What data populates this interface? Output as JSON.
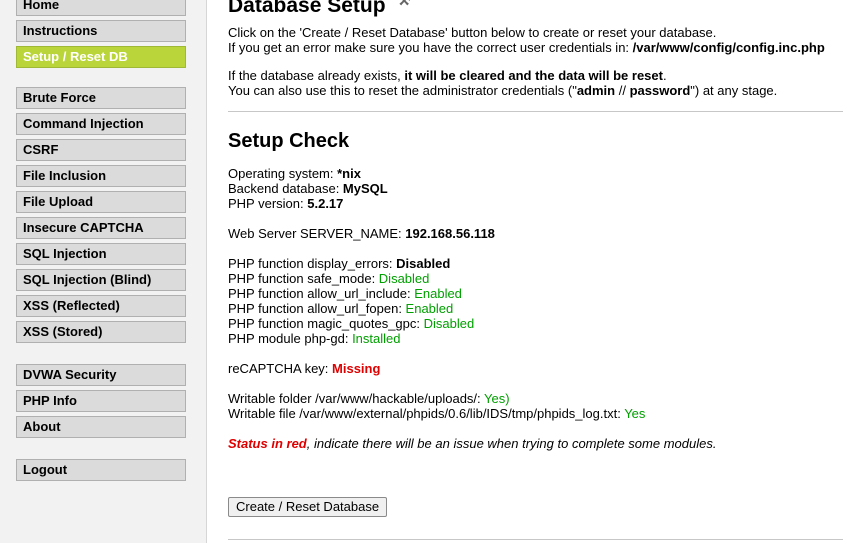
{
  "sidebar": {
    "group1": [
      {
        "label": "Home"
      },
      {
        "label": "Instructions"
      },
      {
        "label": "Setup / Reset DB",
        "selected": true
      }
    ],
    "group2": [
      {
        "label": "Brute Force"
      },
      {
        "label": "Command Injection"
      },
      {
        "label": "CSRF"
      },
      {
        "label": "File Inclusion"
      },
      {
        "label": "File Upload"
      },
      {
        "label": "Insecure CAPTCHA"
      },
      {
        "label": "SQL Injection"
      },
      {
        "label": "SQL Injection (Blind)"
      },
      {
        "label": "XSS (Reflected)"
      },
      {
        "label": "XSS (Stored)"
      }
    ],
    "group3": [
      {
        "label": "DVWA Security"
      },
      {
        "label": "PHP Info"
      },
      {
        "label": "About"
      }
    ],
    "group4": [
      {
        "label": "Logout"
      }
    ]
  },
  "main": {
    "title": "Database Setup",
    "title_icon": "wrench-icon",
    "intro1": "Click on the 'Create / Reset Database' button below to create or reset your database.",
    "intro2_prefix": "If you get an error make sure you have the correct user credentials in: ",
    "intro2_path": "/var/www/config/config.inc.php",
    "cleared_prefix": "If the database already exists, ",
    "cleared_bold": "it will be cleared and the data will be reset",
    "cleared_suffix": ".",
    "reset_prefix": "You can also use this to reset the administrator credentials (\"",
    "reset_user": "admin",
    "reset_sep": " // ",
    "reset_pass": "password",
    "reset_suffix": "\") at any stage.",
    "check_title": "Setup Check",
    "os_label": "Operating system: ",
    "os_value": "*nix",
    "db_label": "Backend database: ",
    "db_value": "MySQL",
    "php_label": "PHP version: ",
    "php_value": "5.2.17",
    "server_label": "Web Server SERVER_NAME: ",
    "server_value": "192.168.56.118",
    "display_errors_label": "PHP function display_errors: ",
    "display_errors_value": "Disabled",
    "safe_mode_label": "PHP function safe_mode: ",
    "safe_mode_value": "Disabled",
    "url_include_label": "PHP function allow_url_include: ",
    "url_include_value": "Enabled",
    "url_fopen_label": "PHP function allow_url_fopen: ",
    "url_fopen_value": "Enabled",
    "magic_quotes_label": "PHP function magic_quotes_gpc: ",
    "magic_quotes_value": "Disabled",
    "gd_label": "PHP module php-gd: ",
    "gd_value": "Installed",
    "recaptcha_label": "reCAPTCHA key: ",
    "recaptcha_value": "Missing",
    "upload_label": "Writable folder /var/www/hackable/uploads/: ",
    "upload_value": "Yes)",
    "phpids_label": "Writable file /var/www/external/phpids/0.6/lib/IDS/tmp/phpids_log.txt: ",
    "phpids_value": "Yes",
    "status_red": "Status in red",
    "status_rest": ", indicate there will be an issue when trying to complete some modules.",
    "button_label": "Create / Reset Database"
  },
  "colors": {
    "selected_menu": "#b9d53a",
    "ok": "#00a000",
    "error": "#e00000"
  }
}
